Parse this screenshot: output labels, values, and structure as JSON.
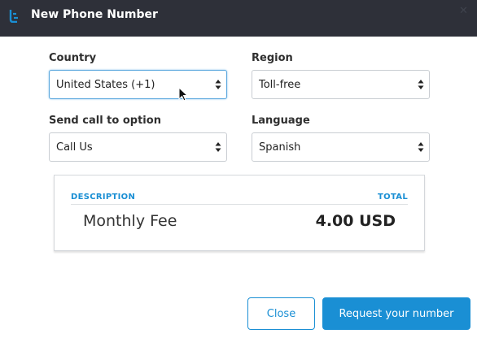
{
  "dialog": {
    "title": "New Phone Number",
    "app_icon": "app-logo-icon",
    "close_icon": "close-icon"
  },
  "form": {
    "country": {
      "label": "Country",
      "value": "United States (+1)"
    },
    "region": {
      "label": "Region",
      "value": "Toll-free"
    },
    "send_call": {
      "label": "Send call to option",
      "value": "Call Us"
    },
    "language": {
      "label": "Language",
      "value": "Spanish"
    }
  },
  "summary": {
    "col_description": "DESCRIPTION",
    "col_total": "TOTAL",
    "rows": [
      {
        "description": "Monthly Fee",
        "total": "4.00 USD"
      }
    ]
  },
  "buttons": {
    "close": "Close",
    "request": "Request your number"
  },
  "colors": {
    "titlebar": "#2e3039",
    "accent": "#1a8fd4"
  }
}
